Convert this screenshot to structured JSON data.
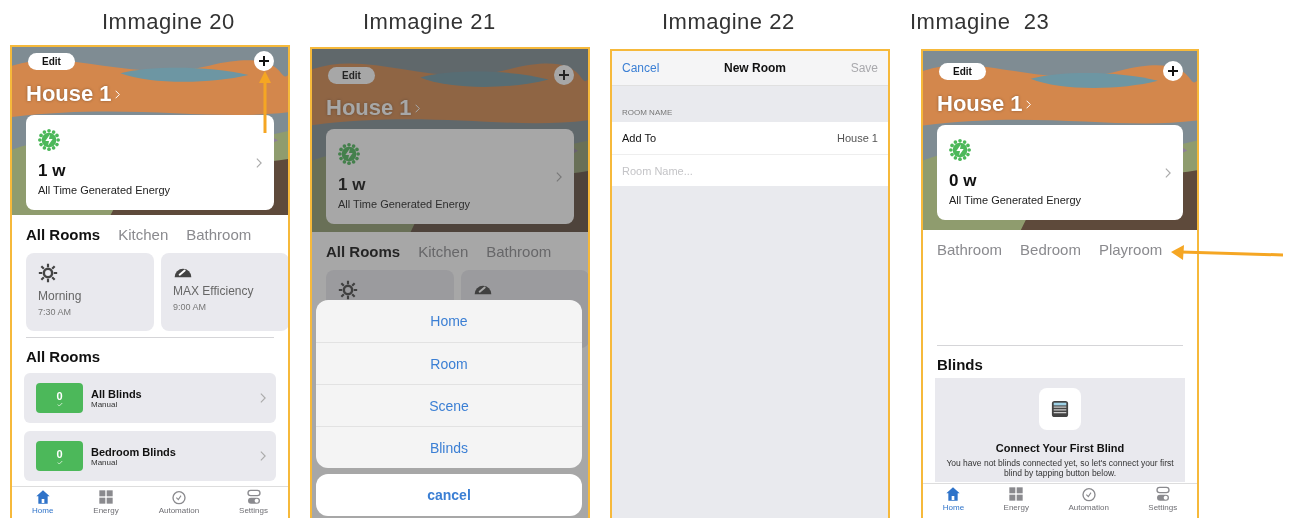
{
  "panels": [
    {
      "caption": "Immagine 20",
      "kind": "home",
      "edit": "Edit",
      "house": "House 1",
      "energy_value": "1 w",
      "energy_label": "All Time Generated Energy",
      "room_tabs": [
        {
          "label": "All Rooms",
          "selected": true
        },
        {
          "label": "Kitchen",
          "selected": false
        },
        {
          "label": "Bathroom",
          "selected": false
        }
      ],
      "scenes": [
        {
          "name": "Morning",
          "time": "7:30 AM"
        },
        {
          "name": "MAX Efficiency",
          "time": "9:00 AM"
        }
      ],
      "section_title": "All Rooms",
      "blinds": [
        {
          "value": "0",
          "name": "All Blinds",
          "mode": "Manual"
        },
        {
          "value": "0",
          "name": "Bedroom Blinds",
          "mode": "Manual"
        }
      ],
      "tab_bar": [
        {
          "label": "Home",
          "selected": true
        },
        {
          "label": "Energy",
          "selected": false
        },
        {
          "label": "Automation",
          "selected": false
        },
        {
          "label": "Settings",
          "selected": false
        }
      ],
      "add_button_highlighted": true
    },
    {
      "caption": "Immagine 21",
      "kind": "home",
      "dimmed": true,
      "edit": "Edit",
      "house": "House 1",
      "energy_value": "1 w",
      "energy_label": "All Time Generated Energy",
      "room_tabs": [
        {
          "label": "All Rooms",
          "selected": true
        },
        {
          "label": "Kitchen",
          "selected": false
        },
        {
          "label": "Bathroom",
          "selected": false
        }
      ],
      "scene_cards_covered": true,
      "action_sheet": {
        "options": [
          "Home",
          "Room",
          "Scene",
          "Blinds"
        ],
        "cancel": "cancel"
      }
    },
    {
      "caption": "Immagine 22",
      "kind": "form",
      "nav": {
        "cancel": "Cancel",
        "title": "New Room",
        "save": "Save",
        "save_disabled": true
      },
      "section_header": "ROOM NAME",
      "rows": [
        {
          "label": "Add To",
          "value": "House 1"
        }
      ],
      "field": {
        "placeholder": "Room Name..."
      }
    },
    {
      "caption": "Immagine  23",
      "kind": "home",
      "edit": "Edit",
      "house": "House 1",
      "energy_value": "0 w",
      "energy_label": "All Time Generated Energy",
      "room_tabs": [
        {
          "label": "Bathroom",
          "selected": false
        },
        {
          "label": "Bedroom",
          "selected": false
        },
        {
          "label": "Playroom",
          "selected": false,
          "highlighted": true
        }
      ],
      "section_title": "Blinds",
      "empty_state": {
        "title": "Connect Your First Blind",
        "text": "You have not blinds connected yet, so let's connect your first blind by tapping button below."
      },
      "tab_bar": [
        {
          "label": "Home",
          "selected": true
        },
        {
          "label": "Energy",
          "selected": false
        },
        {
          "label": "Automation",
          "selected": false
        },
        {
          "label": "Settings",
          "selected": false
        }
      ]
    }
  ]
}
